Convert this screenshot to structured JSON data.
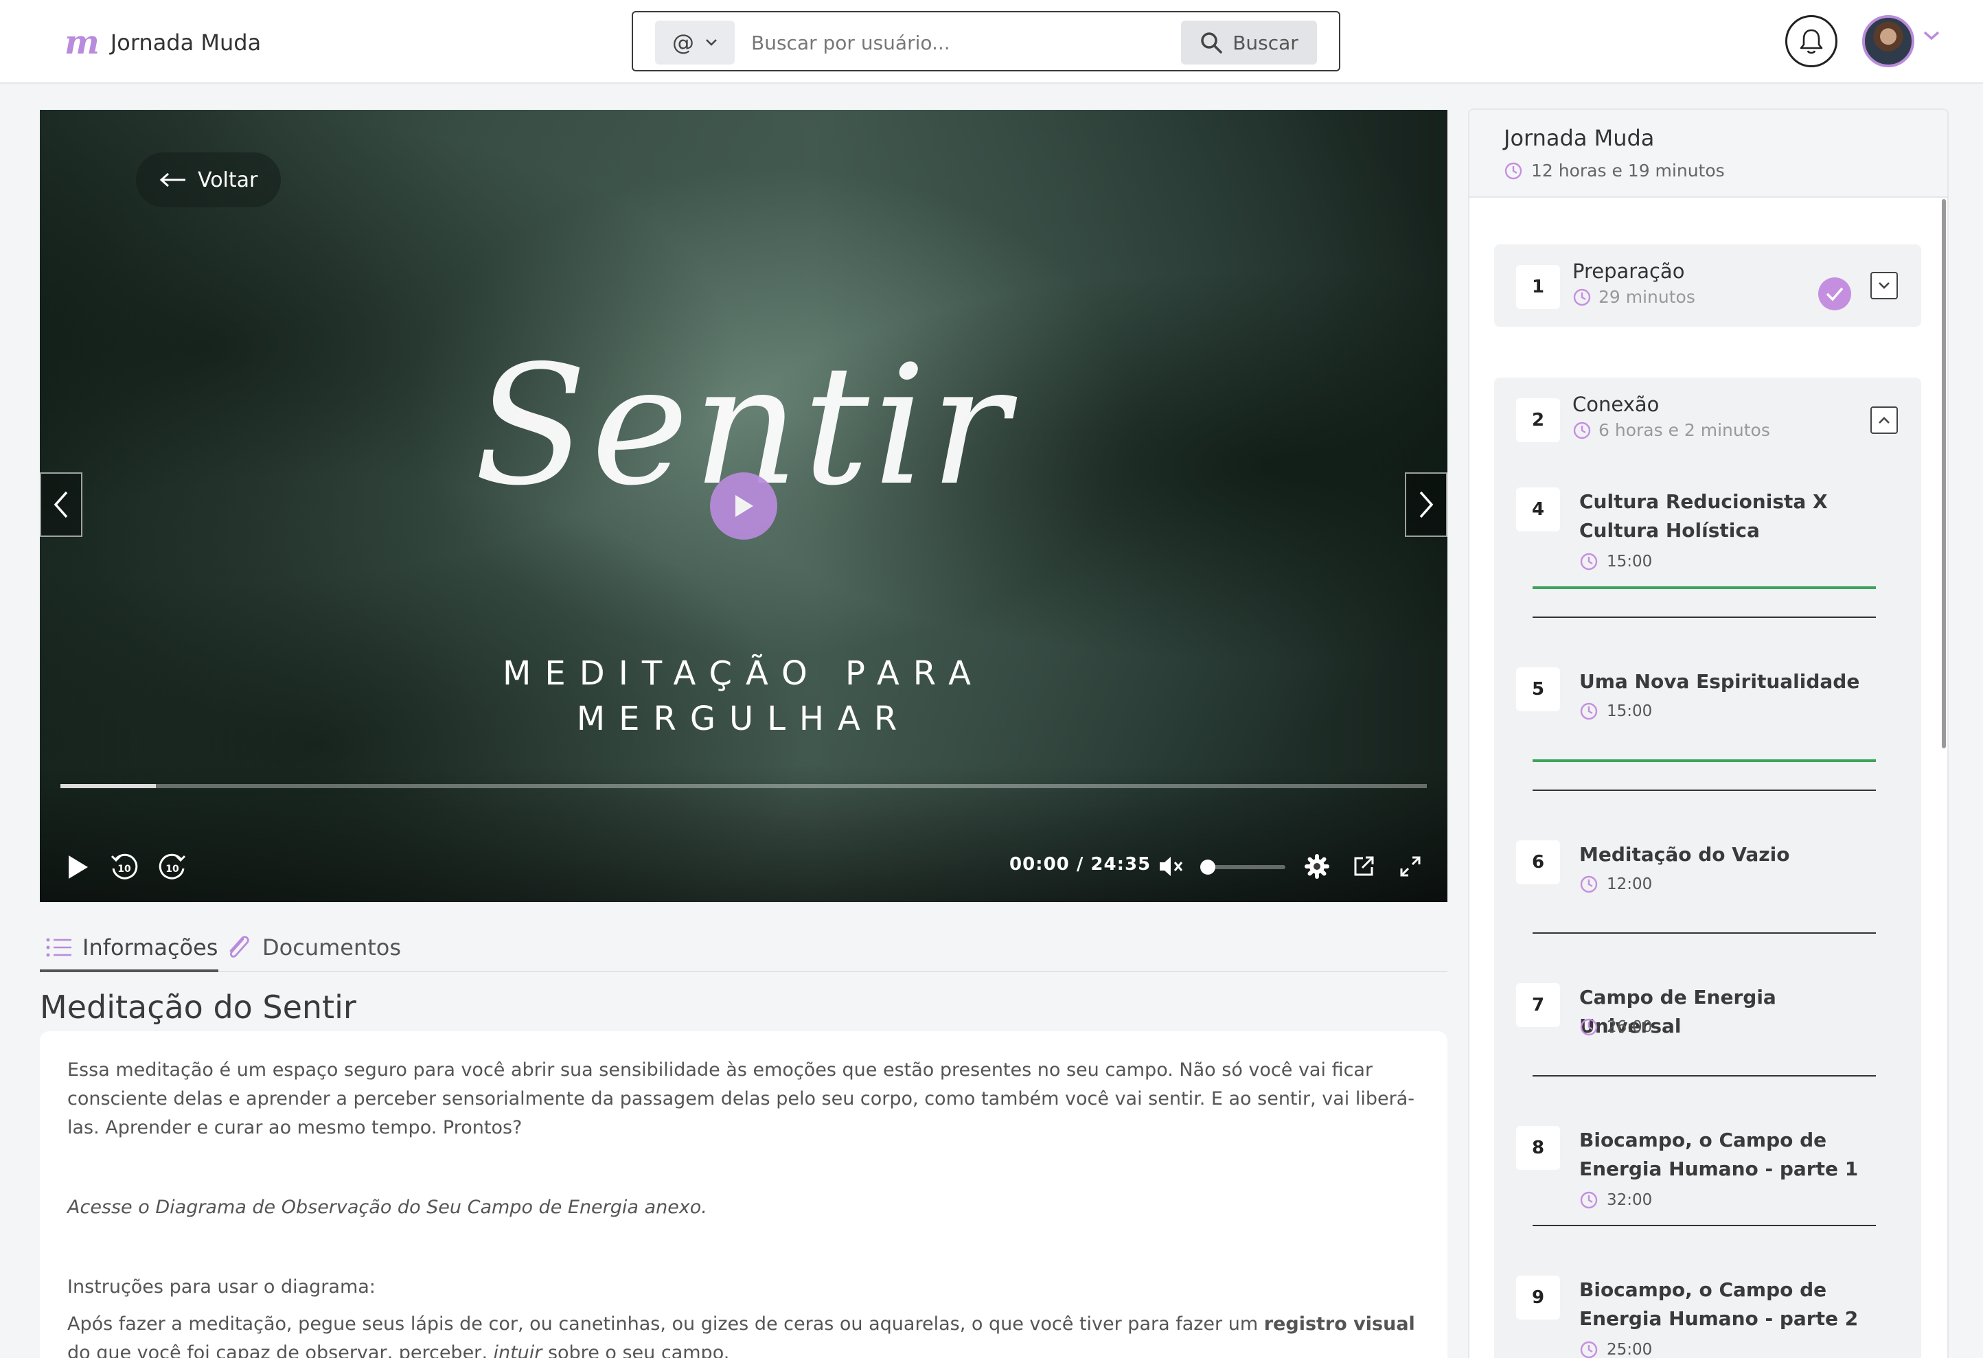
{
  "header": {
    "brand": "Jornada Muda",
    "search": {
      "prefix": "@",
      "placeholder": "Buscar por usuário...",
      "button_label": "Buscar"
    }
  },
  "video": {
    "back_label": "Voltar",
    "title_script": "Sentir",
    "subtitle_line1": "MEDITAÇÃO PARA",
    "subtitle_line2": "MERGULHAR",
    "current_time": "00:00",
    "separator": "/",
    "duration": "24:35",
    "progress_percent": 7,
    "volume_percent": 0,
    "muted": true
  },
  "tabs": [
    {
      "label": "Informações",
      "active": true
    },
    {
      "label": "Documentos",
      "active": false
    }
  ],
  "lesson": {
    "title": "Meditação do Sentir",
    "paragraph1": "Essa meditação é um espaço seguro para você abrir sua sensibilidade às emoções que estão presentes no seu campo. Não só você vai ficar consciente delas e aprender a perceber sensorialmente da passagem delas pelo seu corpo, como também você vai sentir. E ao sentir, vai liberá-las. Aprender e curar ao mesmo tempo. Prontos?",
    "paragraph2": "Acesse o Diagrama de Observação do Seu Campo de Energia anexo.",
    "paragraph3": "Instruções para usar o diagrama:",
    "paragraph4_start": "Após fazer a meditação, pegue seus lápis de cor, ou canetinhas, ou gizes de ceras ou aquarelas, o que você tiver para fazer um ",
    "paragraph4_bold": "registro visual",
    "paragraph4_mid": " do que você foi capaz de observar, perceber, ",
    "paragraph4_italic": "intuir",
    "paragraph4_end": " sobre o seu campo."
  },
  "sidebar": {
    "course_title": "Jornada Muda",
    "course_duration": "12 horas e 19 minutos",
    "modules": [
      {
        "number": "1",
        "title": "Preparação",
        "duration": "29 minutos",
        "completed": true,
        "expanded": false
      },
      {
        "number": "2",
        "title": "Conexão",
        "duration": "6 horas e 2 minutos",
        "completed": false,
        "expanded": true
      }
    ],
    "lessons": [
      {
        "number": "4",
        "title": "Cultura Reducionista X Cultura Holística",
        "duration": "15:00",
        "watched": true
      },
      {
        "number": "5",
        "title": "Uma Nova Espiritualidade",
        "duration": "15:00",
        "watched": true
      },
      {
        "number": "6",
        "title": "Meditação do Vazio",
        "duration": "12:00",
        "watched": false
      },
      {
        "number": "7",
        "title": "Campo de Energia Universal",
        "duration": "26:00",
        "watched": false
      },
      {
        "number": "8",
        "title": "Biocampo, o Campo de Energia Humano - parte 1",
        "duration": "32:00",
        "watched": false
      },
      {
        "number": "9",
        "title": "Biocampo, o Campo de Energia Humano - parte 2",
        "duration": "25:00",
        "watched": false
      }
    ]
  },
  "colors": {
    "accent": "#b98bdc",
    "watched": "#3ea45a",
    "background": "#f4f5f7"
  },
  "icons": [
    "logo-m-icon",
    "chevron-down-icon",
    "search-icon",
    "bell-icon",
    "arrow-left-icon",
    "play-icon",
    "chevron-left-icon",
    "chevron-right-icon",
    "rewind-10-icon",
    "forward-10-icon",
    "mute-icon",
    "gear-icon",
    "popout-icon",
    "fullscreen-icon",
    "list-icon",
    "paperclip-icon",
    "clock-icon",
    "check-icon",
    "chevron-up-icon"
  ]
}
